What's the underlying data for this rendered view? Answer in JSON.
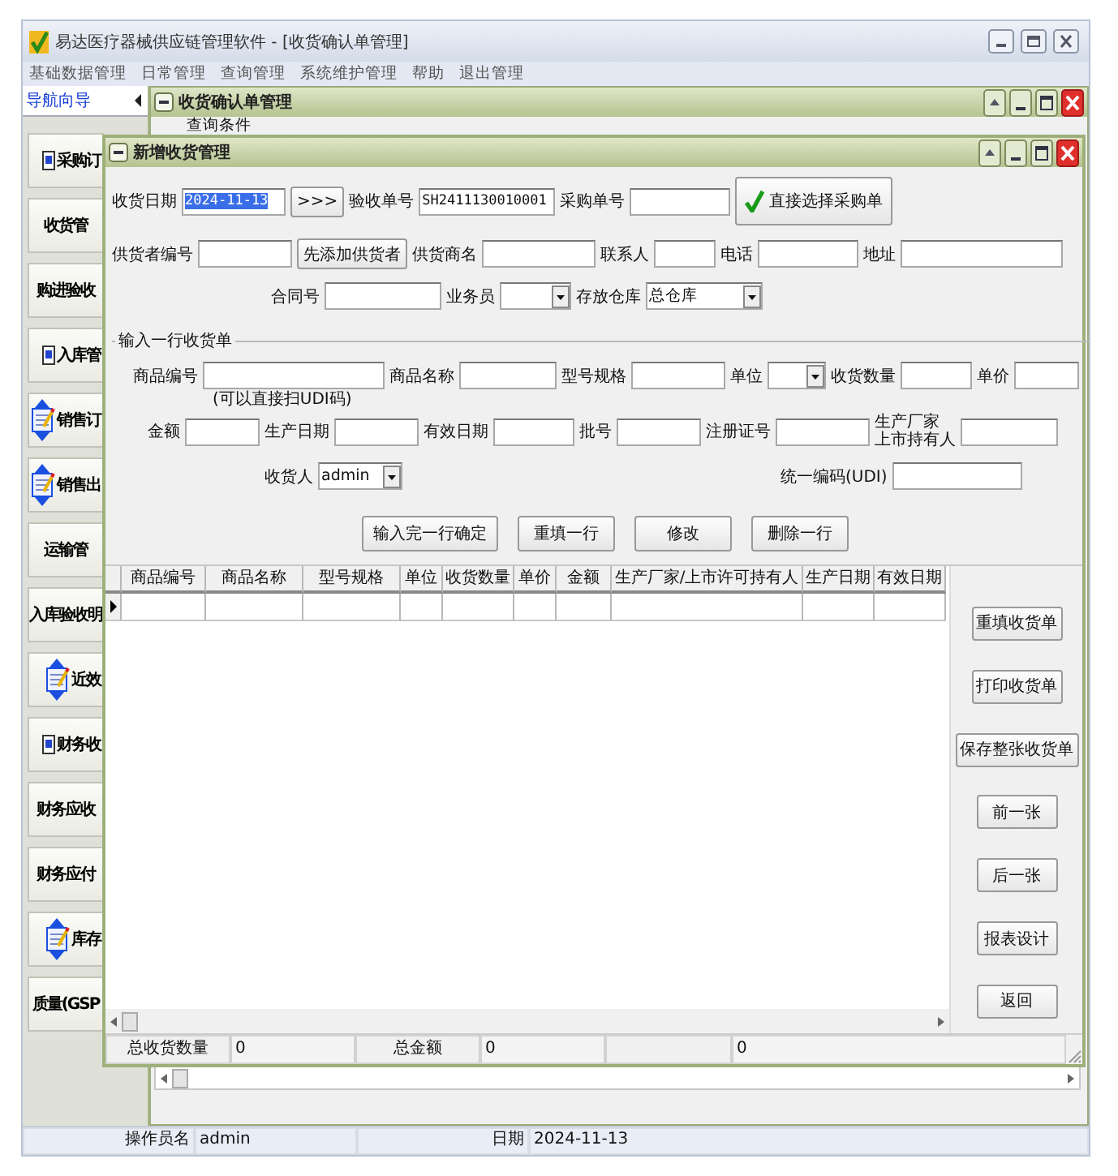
{
  "window": {
    "title": "易达医疗器械供应链管理软件 - [收货确认单管理]"
  },
  "menu": [
    "基础数据管理",
    "日常管理",
    "查询管理",
    "系统维护管理",
    "帮助",
    "退出管理"
  ],
  "navigator": {
    "title": "导航向导",
    "items": [
      {
        "label": "采购订",
        "kind": "doc"
      },
      {
        "label": "收货管",
        "kind": "plain"
      },
      {
        "label": "购进验收",
        "kind": "plain"
      },
      {
        "label": "入库管",
        "kind": "doc"
      },
      {
        "label": "销售订",
        "kind": "arrows"
      },
      {
        "label": "销售出",
        "kind": "arrows"
      },
      {
        "label": "运输管",
        "kind": "plain"
      },
      {
        "label": "入库验收明",
        "kind": "plain"
      },
      {
        "label": "近效",
        "kind": "arrows"
      },
      {
        "label": "财务收",
        "kind": "doc"
      },
      {
        "label": "财务应收",
        "kind": "plain"
      },
      {
        "label": "财务应付",
        "kind": "plain"
      },
      {
        "label": "库存",
        "kind": "arrows"
      },
      {
        "label": "质量(GSP",
        "kind": "plain"
      }
    ]
  },
  "query_window": {
    "title": "收货确认单管理",
    "section": "查询条件"
  },
  "receipt_window": {
    "title": "新增收货管理",
    "header_rows": [
      {
        "items": [
          {
            "kind": "label",
            "text": "收货日期"
          },
          {
            "kind": "field",
            "value": "2024-11-13",
            "highlighted": true
          },
          {
            "kind": "button",
            "text": ">>>"
          },
          {
            "kind": "label",
            "text": "验收单号"
          },
          {
            "kind": "field",
            "value": "SH2411130010001"
          },
          {
            "kind": "label",
            "text": "采购单号"
          },
          {
            "kind": "field"
          },
          {
            "kind": "check-button",
            "text": "直接选择采购单"
          }
        ]
      },
      {
        "items": [
          {
            "kind": "label",
            "text": "供货者编号"
          },
          {
            "kind": "field"
          },
          {
            "kind": "button",
            "text": "先添加供货者"
          },
          {
            "kind": "label",
            "text": "供货商名"
          },
          {
            "kind": "field"
          },
          {
            "kind": "label",
            "text": "联系人"
          },
          {
            "kind": "field"
          },
          {
            "kind": "label",
            "text": "电话"
          },
          {
            "kind": "field"
          },
          {
            "kind": "label",
            "text": "地址"
          },
          {
            "kind": "field"
          }
        ]
      },
      {
        "items": [
          {
            "kind": "label",
            "text": "合同号"
          },
          {
            "kind": "field"
          },
          {
            "kind": "label",
            "text": "业务员"
          },
          {
            "kind": "select"
          },
          {
            "kind": "label",
            "text": "存放仓库"
          },
          {
            "kind": "select",
            "value": "总仓库"
          }
        ]
      }
    ],
    "entry_group": {
      "title": "输入一行收货单",
      "hint": "(可以直接扫UDI码)",
      "rows": [
        {
          "items": [
            {
              "kind": "label",
              "text": "商品编号"
            },
            {
              "kind": "field"
            },
            {
              "kind": "label",
              "text": "商品名称"
            },
            {
              "kind": "field"
            },
            {
              "kind": "label",
              "text": "型号规格"
            },
            {
              "kind": "field"
            },
            {
              "kind": "label",
              "text": "单位"
            },
            {
              "kind": "select"
            },
            {
              "kind": "label",
              "text": "收货数量"
            },
            {
              "kind": "field"
            },
            {
              "kind": "label",
              "text": "单价"
            },
            {
              "kind": "field"
            }
          ]
        },
        {
          "items": [
            {
              "kind": "label",
              "text": "金额"
            },
            {
              "kind": "field"
            },
            {
              "kind": "label",
              "text": "生产日期"
            },
            {
              "kind": "field"
            },
            {
              "kind": "label",
              "text": "有效日期"
            },
            {
              "kind": "field"
            },
            {
              "kind": "label",
              "text": "批号"
            },
            {
              "kind": "field"
            },
            {
              "kind": "label",
              "text": "注册证号"
            },
            {
              "kind": "field"
            },
            {
              "kind": "label",
              "lines": [
                "生产厂家",
                "上市持有人"
              ]
            },
            {
              "kind": "field"
            }
          ]
        },
        {
          "items": [
            {
              "kind": "label",
              "text": "收货人"
            },
            {
              "kind": "select",
              "value": "admin"
            },
            {
              "kind": "label",
              "text": "统一编码(UDI)"
            },
            {
              "kind": "field"
            }
          ]
        }
      ],
      "buttons": [
        "输入完一行确定",
        "重填一行",
        "修改",
        "删除一行"
      ]
    },
    "table": {
      "columns": [
        "商品编号",
        "商品名称",
        "型号规格",
        "单位",
        "收货数量",
        "单价",
        "金额",
        "生产厂家/上市许可持有人",
        "生产日期",
        "有效日期"
      ],
      "rows": [
        {
          "current": true
        }
      ]
    },
    "side_buttons": [
      "重填收货单",
      "打印收货单",
      "保存整张收货单",
      "前一张",
      "后一张",
      "报表设计",
      "返回"
    ],
    "totals": [
      {
        "kind": "label",
        "text": "总收货数量"
      },
      {
        "kind": "value",
        "text": "0"
      },
      {
        "kind": "label",
        "text": "总金额"
      },
      {
        "kind": "value",
        "text": "0"
      },
      {
        "kind": "empty"
      },
      {
        "kind": "value",
        "text": "0"
      }
    ]
  },
  "status_bar": {
    "operator_label": "操作员名",
    "operator": "admin",
    "date_label": "日期",
    "date": "2024-11-13"
  }
}
